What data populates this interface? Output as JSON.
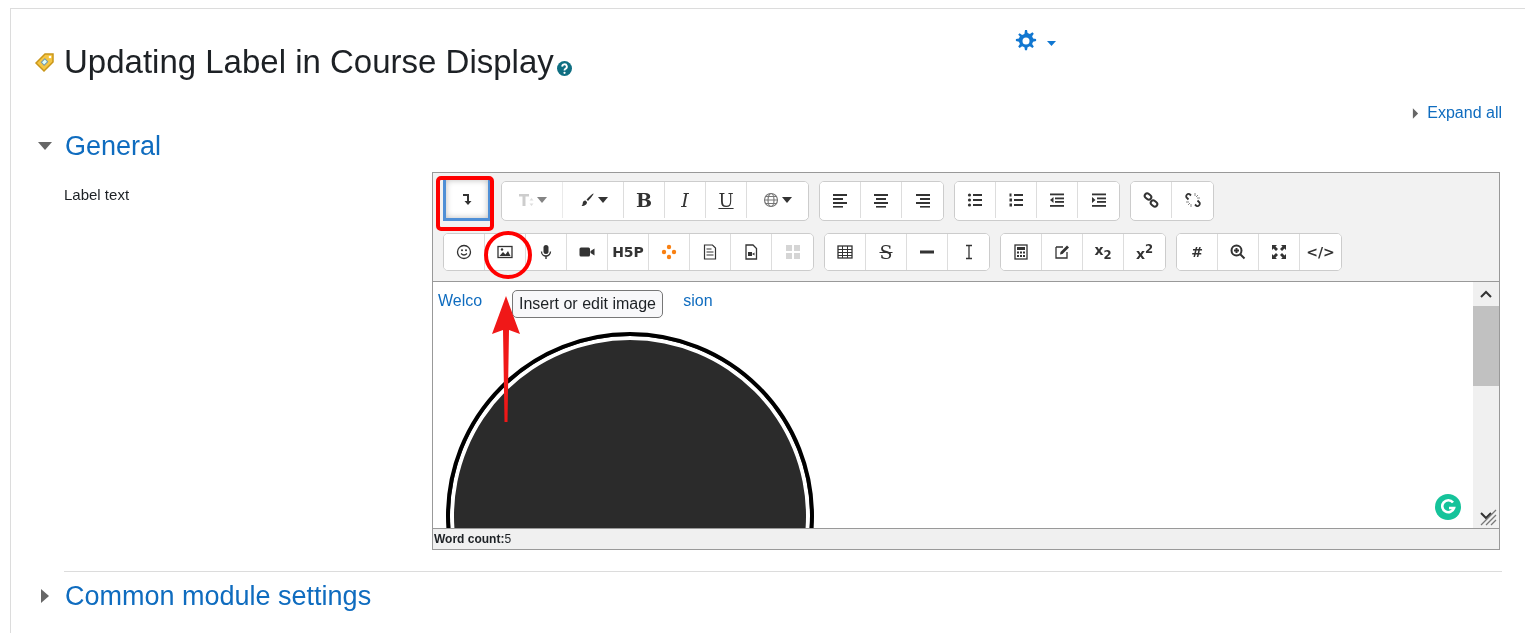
{
  "page": {
    "title": "Updating Label in Course Display",
    "expand_all": "Expand all"
  },
  "general": {
    "title": "General",
    "expanded": true,
    "field_label": "Label text"
  },
  "editor": {
    "toolbar": {
      "rows": [
        [
          [
            {
              "kind": "icon",
              "active": true,
              "disabled": false
            }
          ],
          [
            {
              "kind": "icon",
              "active": false,
              "disabled": true
            },
            {
              "kind": "icon",
              "active": false,
              "disabled": false
            },
            {
              "kind": "bold",
              "label": "B",
              "active": false,
              "disabled": false
            },
            {
              "kind": "italic",
              "label": "I",
              "active": false,
              "disabled": false
            },
            {
              "kind": "underline",
              "label": "U",
              "active": false,
              "disabled": false
            },
            {
              "kind": "icon",
              "active": false,
              "disabled": false
            }
          ],
          [
            {
              "kind": "icon",
              "active": false,
              "disabled": false
            },
            {
              "kind": "icon",
              "active": false,
              "disabled": false
            },
            {
              "kind": "icon",
              "active": false,
              "disabled": false
            }
          ],
          [
            {
              "kind": "icon",
              "active": false,
              "disabled": false
            },
            {
              "kind": "icon",
              "active": false,
              "disabled": false
            },
            {
              "kind": "icon",
              "active": false,
              "disabled": false
            },
            {
              "kind": "icon",
              "active": false,
              "disabled": false
            }
          ],
          [
            {
              "kind": "icon",
              "active": false,
              "disabled": false
            },
            {
              "kind": "icon",
              "active": false,
              "disabled": false
            }
          ]
        ],
        [
          [
            {
              "kind": "icon",
              "active": false,
              "disabled": false
            },
            {
              "kind": "icon",
              "active": false,
              "disabled": false
            },
            {
              "kind": "icon",
              "active": false,
              "disabled": false
            },
            {
              "kind": "icon",
              "active": false,
              "disabled": false
            },
            {
              "kind": "text",
              "label": "H5P",
              "active": false,
              "disabled": false
            },
            {
              "kind": "icon",
              "active": false,
              "disabled": false
            },
            {
              "kind": "icon",
              "active": false,
              "disabled": false
            },
            {
              "kind": "icon",
              "active": false,
              "disabled": false
            },
            {
              "kind": "icon",
              "active": false,
              "disabled": true
            }
          ],
          [
            {
              "kind": "icon",
              "active": false,
              "disabled": false
            },
            {
              "kind": "strike",
              "label": "S",
              "active": false,
              "disabled": false
            },
            {
              "kind": "icon",
              "active": false,
              "disabled": false
            },
            {
              "kind": "icon",
              "active": false,
              "disabled": false
            }
          ],
          [
            {
              "kind": "icon",
              "active": false,
              "disabled": false
            },
            {
              "kind": "icon",
              "active": false,
              "disabled": false
            },
            {
              "kind": "text",
              "label": "x$_{2}$",
              "active": false,
              "disabled": false
            },
            {
              "kind": "text",
              "label": "x$^{2}$",
              "active": false,
              "disabled": false
            }
          ],
          [
            {
              "kind": "text",
              "label": "#",
              "active": false,
              "disabled": false
            },
            {
              "kind": "icon",
              "active": false,
              "disabled": false
            },
            {
              "kind": "icon",
              "active": false,
              "disabled": false
            },
            {
              "kind": "text",
              "label": "</>",
              "active": false,
              "disabled": false
            }
          ]
        ]
      ]
    },
    "content": {
      "text_before": "Welco",
      "text_after": "sion",
      "tooltip": "Insert or edit image"
    },
    "word_count": "**Word count:**5"
  },
  "collapsed_section": {
    "title": "Common module settings",
    "expanded": false
  }
}
